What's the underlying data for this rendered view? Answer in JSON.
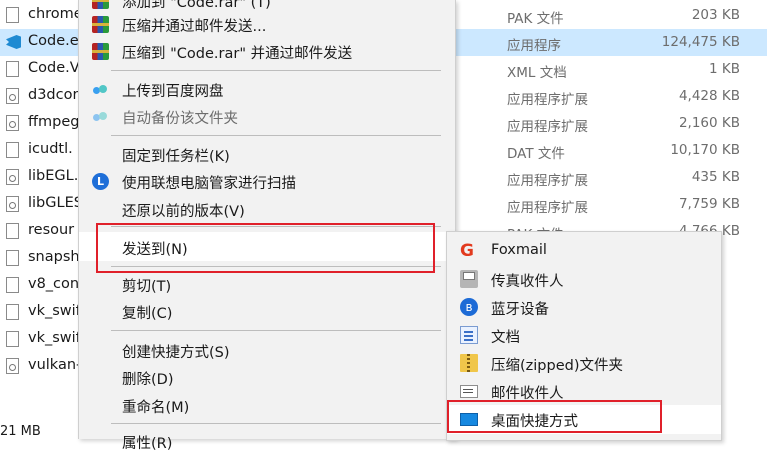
{
  "files": [
    {
      "name": "chrome",
      "type": "PAK 文件",
      "size": "203 KB",
      "icon": "file-icon"
    },
    {
      "name": "Code.e",
      "type": "应用程序",
      "size": "124,475 KB",
      "icon": "vscode-icon",
      "selected": true
    },
    {
      "name": "Code.V",
      "type": "XML 文档",
      "size": "1 KB",
      "icon": "file-icon"
    },
    {
      "name": "d3dcor",
      "type": "应用程序扩展",
      "size": "4,428 KB",
      "icon": "gear-file-icon"
    },
    {
      "name": "ffmpeg",
      "type": "应用程序扩展",
      "size": "2,160 KB",
      "icon": "gear-file-icon"
    },
    {
      "name": "icudtl.",
      "type": "DAT 文件",
      "size": "10,170 KB",
      "icon": "file-icon"
    },
    {
      "name": "libEGL.",
      "type": "应用程序扩展",
      "size": "435 KB",
      "icon": "gear-file-icon"
    },
    {
      "name": "libGLES",
      "type": "应用程序扩展",
      "size": "7,759 KB",
      "icon": "gear-file-icon"
    },
    {
      "name": "resour",
      "type": "PAK 文件",
      "size": "4,766 KB",
      "icon": "file-icon"
    },
    {
      "name": "snapsh",
      "type": "",
      "size": "",
      "icon": "file-icon"
    },
    {
      "name": "v8_con",
      "type": "",
      "size": "",
      "icon": "file-icon"
    },
    {
      "name": "vk_swif",
      "type": "",
      "size": "",
      "icon": "file-icon"
    },
    {
      "name": "vk_swif",
      "type": "",
      "size": "",
      "icon": "file-icon"
    },
    {
      "name": "vulkan-",
      "type": "",
      "size": "",
      "icon": "gear-file-icon"
    }
  ],
  "status_size": "21 MB",
  "context_menu": {
    "add_to_archive_email": "添加到 \"Code.rar\" (T)",
    "compress_email": "压缩并通过邮件发送...",
    "compress_rar_email": "压缩到 \"Code.rar\" 并通过邮件发送",
    "upload_baidu": "上传到百度网盘",
    "auto_backup": "自动备份该文件夹",
    "pin_taskbar": "固定到任务栏(K)",
    "lenovo_scan": "使用联想电脑管家进行扫描",
    "restore_previous": "还原以前的版本(V)",
    "send_to": "发送到(N)",
    "cut": "剪切(T)",
    "copy": "复制(C)",
    "create_shortcut": "创建快捷方式(S)",
    "delete": "删除(D)",
    "rename": "重命名(M)",
    "properties": "属性(R)",
    "submenu_arrow": "〉"
  },
  "send_to_menu": {
    "foxmail": "Foxmail",
    "fax_recipient": "传真收件人",
    "bluetooth": "蓝牙设备",
    "documents": "文档",
    "compressed_folder": "压缩(zipped)文件夹",
    "mail_recipient": "邮件收件人",
    "desktop_shortcut": "桌面快捷方式"
  },
  "icon_glyphs": {
    "foxmail": "G",
    "bluetooth": "ʙ",
    "lenovo": "L"
  },
  "colors": {
    "selection": "#cce8ff",
    "annotation_red": "#e0202a",
    "menu_bg": "#f2f2f2"
  }
}
